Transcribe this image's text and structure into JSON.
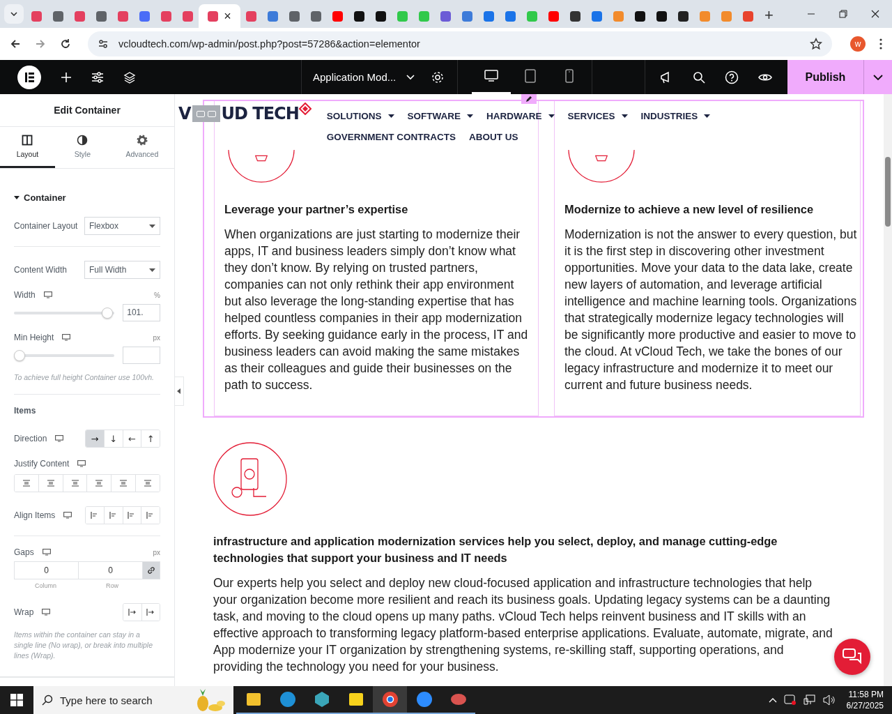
{
  "browser": {
    "tabs": [
      {
        "color": "#e4405f",
        "selected": false
      },
      {
        "color": "#5f6368",
        "selected": false
      },
      {
        "color": "#e4405f",
        "selected": false
      },
      {
        "color": "#5f6368",
        "selected": false
      },
      {
        "color": "#e4405f",
        "selected": false
      },
      {
        "color": "#4a6cf7",
        "selected": false
      },
      {
        "color": "#e4405f",
        "selected": false
      },
      {
        "color": "#e4405f",
        "selected": false
      },
      {
        "color": "#e4405f",
        "selected": true
      },
      {
        "color": "#e4405f",
        "selected": false
      },
      {
        "color": "#3d7bd9",
        "selected": false
      },
      {
        "color": "#5f6368",
        "selected": false
      },
      {
        "color": "#5f6368",
        "selected": false
      },
      {
        "color": "#ff0000",
        "selected": false
      },
      {
        "color": "#111111",
        "selected": false
      },
      {
        "color": "#111111",
        "selected": false
      },
      {
        "color": "#31c94b",
        "selected": false
      },
      {
        "color": "#31c94b",
        "selected": false
      },
      {
        "color": "#6b5bd6",
        "selected": false
      },
      {
        "color": "#3d7bd9",
        "selected": false
      },
      {
        "color": "#1a73e8",
        "selected": false
      },
      {
        "color": "#1a73e8",
        "selected": false
      },
      {
        "color": "#31c94b",
        "selected": false
      },
      {
        "color": "#ff0000",
        "selected": false
      },
      {
        "color": "#333333",
        "selected": false
      },
      {
        "color": "#1a73e8",
        "selected": false
      },
      {
        "color": "#f28b2c",
        "selected": false
      },
      {
        "color": "#111111",
        "selected": false
      },
      {
        "color": "#111111",
        "selected": false
      },
      {
        "color": "#222222",
        "selected": false
      },
      {
        "color": "#f28b2c",
        "selected": false
      },
      {
        "color": "#f28b2c",
        "selected": false
      },
      {
        "color": "#e8432d",
        "selected": false
      }
    ],
    "close_label": "×",
    "new_tab": "+",
    "url": "vcloudtech.com/wp-admin/post.php?post=57286&action=elementor",
    "profile": "w"
  },
  "toolbar": {
    "page_title": "Application Mod...",
    "publish": "Publish",
    "devices": [
      {
        "kind": "desktop",
        "selected": true
      },
      {
        "kind": "tablet",
        "selected": false
      },
      {
        "kind": "mobile",
        "selected": false
      }
    ]
  },
  "panel": {
    "title": "Edit Container",
    "tabs": [
      {
        "label": "Layout",
        "kind": "layout",
        "selected": true
      },
      {
        "label": "Style",
        "kind": "style",
        "selected": false
      },
      {
        "label": "Advanced",
        "kind": "advanced",
        "selected": false
      }
    ],
    "section": "Container",
    "container_layout": {
      "label": "Container Layout",
      "value": "Flexbox"
    },
    "content_width": {
      "label": "Content Width",
      "value": "Full Width"
    },
    "width": {
      "label": "Width",
      "unit": "%",
      "level": 0.98,
      "value": "101."
    },
    "min_height": {
      "label": "Min Height",
      "unit": "px",
      "level": 0
    },
    "hint": "To achieve full height Container use 100vh.",
    "items_heading": "Items",
    "direction": {
      "label": "Direction",
      "options": [
        {
          "glyph": "→",
          "selected": true
        },
        {
          "glyph": "↓",
          "selected": false
        },
        {
          "glyph": "←",
          "selected": false
        },
        {
          "glyph": "↑",
          "selected": false
        }
      ]
    },
    "justify": {
      "label": "Justify Content",
      "options": [
        {
          "selected": false
        },
        {
          "selected": false
        },
        {
          "selected": false
        },
        {
          "selected": false
        },
        {
          "selected": false
        },
        {
          "selected": false
        }
      ]
    },
    "align": {
      "label": "Align Items",
      "options": [
        {
          "selected": false
        },
        {
          "selected": false
        },
        {
          "selected": false
        },
        {
          "selected": false
        }
      ]
    },
    "gaps": {
      "label": "Gaps",
      "unit": "px",
      "column": "0",
      "row": "0",
      "column_label": "Column",
      "row_label": "Row"
    },
    "wrap": {
      "label": "Wrap",
      "options": [
        {
          "selected": false
        },
        {
          "selected": false
        }
      ]
    },
    "wrap_hint": "Items within the container can stay in a single line (No wrap), or break into multiple lines (Wrap)."
  },
  "site": {
    "logo_left": "V",
    "logo_right": "UD TECH",
    "nav": [
      {
        "label": "SOLUTIONS",
        "dropdown": true
      },
      {
        "label": "SOFTWARE",
        "dropdown": true
      },
      {
        "label": "HARDWARE",
        "dropdown": true
      },
      {
        "label": "SERVICES",
        "dropdown": true
      },
      {
        "label": "INDUSTRIES",
        "dropdown": true
      },
      {
        "label": "GOVERNMENT CONTRACTS",
        "dropdown": false
      },
      {
        "label": "ABOUT US",
        "dropdown": false
      }
    ],
    "columns": [
      {
        "title": "Leverage your partner’s expertise",
        "body": "When organizations are just starting to modernize their apps, IT and business leaders simply don’t know what they don’t know. By relying on trusted partners, companies can not only rethink their app environment but also leverage the long-standing expertise that has helped countless companies in their app modernization efforts. By seeking guidance early in the process, IT and business leaders can avoid making the same mistakes as their colleagues and guide their businesses on the path to success."
      },
      {
        "title": "Modernize to achieve a new level of resilience",
        "body": "Modernization is not the answer to every question, but it is the first step in discovering other investment opportunities. Move your data to the data lake, create new layers of automation, and leverage artificial intelligence and machine learning tools. Organizations that strategically modernize legacy technologies will be significantly more productive and easier to move to the cloud. At vCloud Tech, we take the bones of our legacy infrastructure and modernize it to meet our current and future business needs."
      }
    ],
    "section": {
      "title": "infrastructure and application modernization services help you select, deploy, and manage cutting-edge technologies that support your business and IT needs",
      "body": "Our experts help you select and deploy new cloud-focused application and infrastructure technologies that help your organization become more resilient and reach its business goals. Updating legacy systems can be a daunting task, and moving to the cloud opens up many paths. vCloud Tech helps reinvent business and IT skills with an effective approach to transforming legacy platform-based enterprise applications. Evaluate, automate, migrate, and App modernize your IT organization by strengthening systems, re-skilling staff, supporting operations, and providing the technology you need for your business."
    }
  },
  "taskbar": {
    "search_placeholder": "Type here to search",
    "apps": [
      {
        "kind": "folder",
        "selected": false
      },
      {
        "kind": "edge",
        "selected": false
      },
      {
        "kind": "hexagon",
        "selected": false
      },
      {
        "kind": "notes",
        "selected": false
      },
      {
        "kind": "chrome",
        "selected": true
      },
      {
        "kind": "zoom",
        "selected": false
      },
      {
        "kind": "paint",
        "selected": false
      }
    ],
    "time": "11:58 PM",
    "date": "6/27/2025"
  }
}
